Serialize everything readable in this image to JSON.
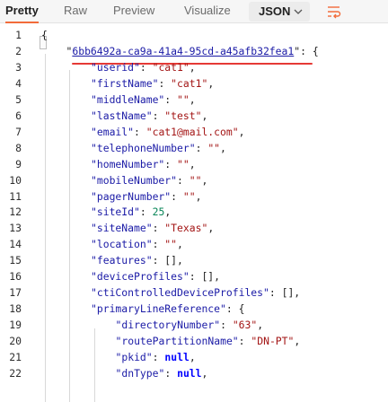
{
  "toolbar": {
    "tabs": [
      {
        "label": "Pretty",
        "active": true
      },
      {
        "label": "Raw",
        "active": false
      },
      {
        "label": "Preview",
        "active": false
      },
      {
        "label": "Visualize",
        "active": false
      }
    ],
    "format": "JSON",
    "wrap_icon": "wrap-lines-icon"
  },
  "editor": {
    "line_numbers": [
      "1",
      "2",
      "3",
      "4",
      "5",
      "6",
      "7",
      "8",
      "9",
      "10",
      "11",
      "12",
      "13",
      "14",
      "15",
      "16",
      "17",
      "18",
      "19",
      "20",
      "21",
      "22"
    ],
    "lines": [
      {
        "indent": 0,
        "parts": [
          [
            "p",
            "{"
          ]
        ]
      },
      {
        "indent": 1,
        "parts": [
          [
            "p",
            "\""
          ],
          [
            "link",
            "6bb6492a-ca9a-41a4-95cd-a45afb32fea1"
          ],
          [
            "p",
            "\": {"
          ]
        ]
      },
      {
        "indent": 2,
        "parts": [
          [
            "k",
            "\"userid\""
          ],
          [
            "p",
            ": "
          ],
          [
            "s",
            "\"cat1\""
          ],
          [
            "p",
            ","
          ]
        ]
      },
      {
        "indent": 2,
        "parts": [
          [
            "k",
            "\"firstName\""
          ],
          [
            "p",
            ": "
          ],
          [
            "s",
            "\"cat1\""
          ],
          [
            "p",
            ","
          ]
        ]
      },
      {
        "indent": 2,
        "parts": [
          [
            "k",
            "\"middleName\""
          ],
          [
            "p",
            ": "
          ],
          [
            "s",
            "\"\""
          ],
          [
            "p",
            ","
          ]
        ]
      },
      {
        "indent": 2,
        "parts": [
          [
            "k",
            "\"lastName\""
          ],
          [
            "p",
            ": "
          ],
          [
            "s",
            "\"test\""
          ],
          [
            "p",
            ","
          ]
        ]
      },
      {
        "indent": 2,
        "parts": [
          [
            "k",
            "\"email\""
          ],
          [
            "p",
            ": "
          ],
          [
            "s",
            "\"cat1@mail.com\""
          ],
          [
            "p",
            ","
          ]
        ]
      },
      {
        "indent": 2,
        "parts": [
          [
            "k",
            "\"telephoneNumber\""
          ],
          [
            "p",
            ": "
          ],
          [
            "s",
            "\"\""
          ],
          [
            "p",
            ","
          ]
        ]
      },
      {
        "indent": 2,
        "parts": [
          [
            "k",
            "\"homeNumber\""
          ],
          [
            "p",
            ": "
          ],
          [
            "s",
            "\"\""
          ],
          [
            "p",
            ","
          ]
        ]
      },
      {
        "indent": 2,
        "parts": [
          [
            "k",
            "\"mobileNumber\""
          ],
          [
            "p",
            ": "
          ],
          [
            "s",
            "\"\""
          ],
          [
            "p",
            ","
          ]
        ]
      },
      {
        "indent": 2,
        "parts": [
          [
            "k",
            "\"pagerNumber\""
          ],
          [
            "p",
            ": "
          ],
          [
            "s",
            "\"\""
          ],
          [
            "p",
            ","
          ]
        ]
      },
      {
        "indent": 2,
        "parts": [
          [
            "k",
            "\"siteId\""
          ],
          [
            "p",
            ": "
          ],
          [
            "n",
            "25"
          ],
          [
            "p",
            ","
          ]
        ]
      },
      {
        "indent": 2,
        "parts": [
          [
            "k",
            "\"siteName\""
          ],
          [
            "p",
            ": "
          ],
          [
            "s",
            "\"Texas\""
          ],
          [
            "p",
            ","
          ]
        ]
      },
      {
        "indent": 2,
        "parts": [
          [
            "k",
            "\"location\""
          ],
          [
            "p",
            ": "
          ],
          [
            "s",
            "\"\""
          ],
          [
            "p",
            ","
          ]
        ]
      },
      {
        "indent": 2,
        "parts": [
          [
            "k",
            "\"features\""
          ],
          [
            "p",
            ": [],"
          ]
        ]
      },
      {
        "indent": 2,
        "parts": [
          [
            "k",
            "\"deviceProfiles\""
          ],
          [
            "p",
            ": [],"
          ]
        ]
      },
      {
        "indent": 2,
        "parts": [
          [
            "k",
            "\"ctiControlledDeviceProfiles\""
          ],
          [
            "p",
            ": [],"
          ]
        ]
      },
      {
        "indent": 2,
        "parts": [
          [
            "k",
            "\"primaryLineReference\""
          ],
          [
            "p",
            ": {"
          ]
        ]
      },
      {
        "indent": 3,
        "parts": [
          [
            "k",
            "\"directoryNumber\""
          ],
          [
            "p",
            ": "
          ],
          [
            "s",
            "\"63\""
          ],
          [
            "p",
            ","
          ]
        ]
      },
      {
        "indent": 3,
        "parts": [
          [
            "k",
            "\"routePartitionName\""
          ],
          [
            "p",
            ": "
          ],
          [
            "s",
            "\"DN-PT\""
          ],
          [
            "p",
            ","
          ]
        ]
      },
      {
        "indent": 3,
        "parts": [
          [
            "k",
            "\"pkid\""
          ],
          [
            "p",
            ": "
          ],
          [
            "w",
            "null"
          ],
          [
            "p",
            ","
          ]
        ]
      },
      {
        "indent": 3,
        "parts": [
          [
            "k",
            "\"dnType\""
          ],
          [
            "p",
            ": "
          ],
          [
            "w",
            "null"
          ],
          [
            "p",
            ","
          ]
        ]
      }
    ]
  }
}
